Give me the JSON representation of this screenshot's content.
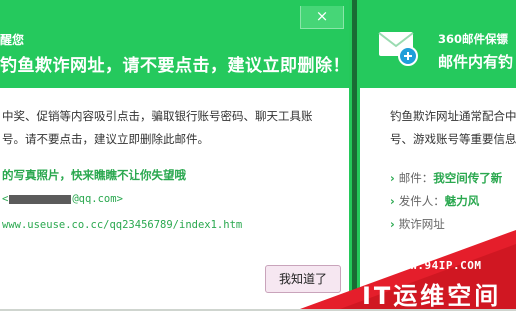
{
  "left_popup": {
    "header_line1": "醒您",
    "header_line2": "钓鱼欺诈网址，请不要点击，建议立即删除！",
    "close_label": "×",
    "body_line1": "中奖、促销等内容吸引点击，骗取银行账号密码、聊天工具账",
    "body_line2": "号。请不要点击，建议立即删除此邮件。",
    "subject_line": "的写真照片，快来瞧瞧不让你失望哦",
    "email_prefix": "<",
    "email_suffix": "@qq.com>",
    "url_line": "www.useuse.co.cc/qq23456789/index1.htm",
    "confirm_button": "我知道了"
  },
  "right_popup": {
    "header_line1": "360邮件保镖",
    "header_line2": "邮件内有钓",
    "body_line1": "钓鱼欺诈网址通常配合中",
    "body_line2": "号、游戏账号等重要信息",
    "bullets": [
      {
        "label": "邮件：",
        "value": "我空间传了新"
      },
      {
        "label": "发件人：",
        "value": "魅力风"
      },
      {
        "label": "欺诈网址",
        "value": ""
      }
    ],
    "accent_color": "#25c95d"
  },
  "watermark": {
    "site": "WWW.94IP.COM",
    "brand": "IT运维空间",
    "color": "#e51e2b"
  }
}
